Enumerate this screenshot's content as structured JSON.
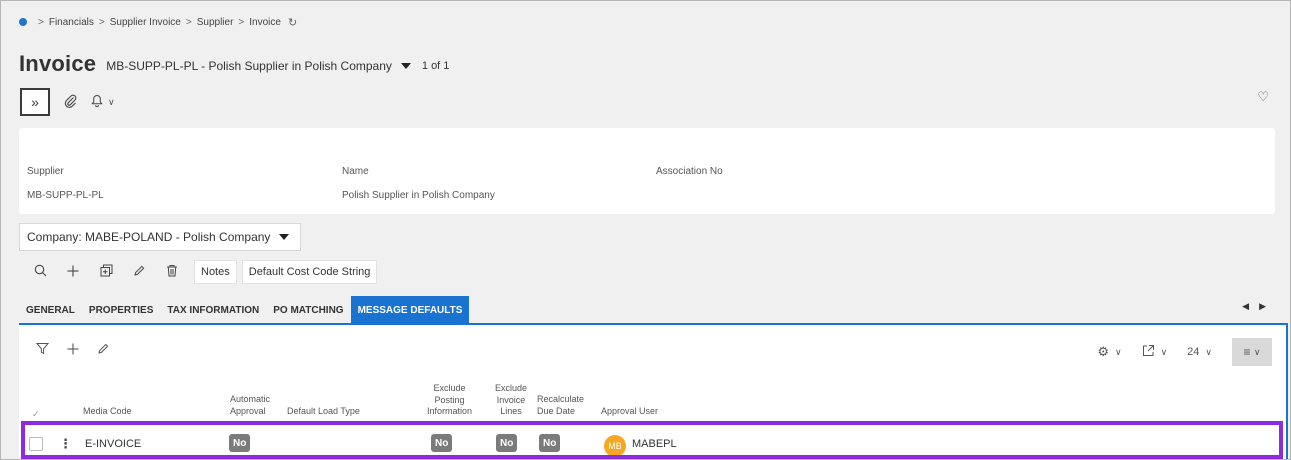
{
  "breadcrumb": {
    "items": [
      "Financials",
      "Supplier Invoice",
      "Supplier",
      "Invoice"
    ]
  },
  "header": {
    "title": "Invoice",
    "record": "MB-SUPP-PL-PL - Polish Supplier in Polish Company",
    "count": "1 of 1"
  },
  "fields": {
    "supplier_label": "Supplier",
    "supplier_value": "MB-SUPP-PL-PL",
    "name_label": "Name",
    "name_value": "Polish Supplier in Polish Company",
    "association_label": "Association No",
    "association_value": ""
  },
  "company": {
    "label": "Company: MABE-POLAND - Polish Company"
  },
  "toolbar": {
    "notes_label": "Notes",
    "cost_code_label": "Default Cost Code String"
  },
  "tabs": [
    {
      "label": "GENERAL"
    },
    {
      "label": "PROPERTIES"
    },
    {
      "label": "TAX INFORMATION"
    },
    {
      "label": "PO MATCHING"
    },
    {
      "label": "MESSAGE DEFAULTS",
      "active": true
    }
  ],
  "table": {
    "page_size": "24",
    "columns": {
      "media_code": "Media Code",
      "automatic_approval_1": "Automatic",
      "automatic_approval_2": "Approval",
      "default_load_type": "Default Load Type",
      "exclude_posting_1": "Exclude",
      "exclude_posting_2": "Posting",
      "exclude_posting_3": "Information",
      "exclude_lines_1": "Exclude",
      "exclude_lines_2": "Invoice",
      "exclude_lines_3": "Lines",
      "recalc_1": "Recalculate",
      "recalc_2": "Due Date",
      "approval_user": "Approval User"
    },
    "rows": [
      {
        "media_code": "E-INVOICE",
        "automatic_approval": "No",
        "default_load_type": "",
        "exclude_posting": "No",
        "exclude_lines": "No",
        "recalculate": "No",
        "approval_user_initials": "MB",
        "approval_user": "MABEPL"
      }
    ]
  },
  "colors": {
    "accent": "#1a73d1",
    "highlight": "#8d2be2",
    "badge": "#7b7b7b",
    "avatar": "#f5a623"
  },
  "icons": {
    "breadcrumb": "home-dot-icon",
    "refresh": "refresh-icon",
    "expand": "double-chevron-right-icon",
    "attachment": "paperclip-icon",
    "notifications": "bell-icon",
    "favorite": "heart-icon",
    "search": "search-icon",
    "add": "plus-icon",
    "duplicate": "duplicate-icon",
    "edit": "pencil-icon",
    "delete": "trash-icon",
    "filter": "filter-icon",
    "settings": "gear-icon",
    "export": "export-icon",
    "list_view": "list-view-icon"
  }
}
